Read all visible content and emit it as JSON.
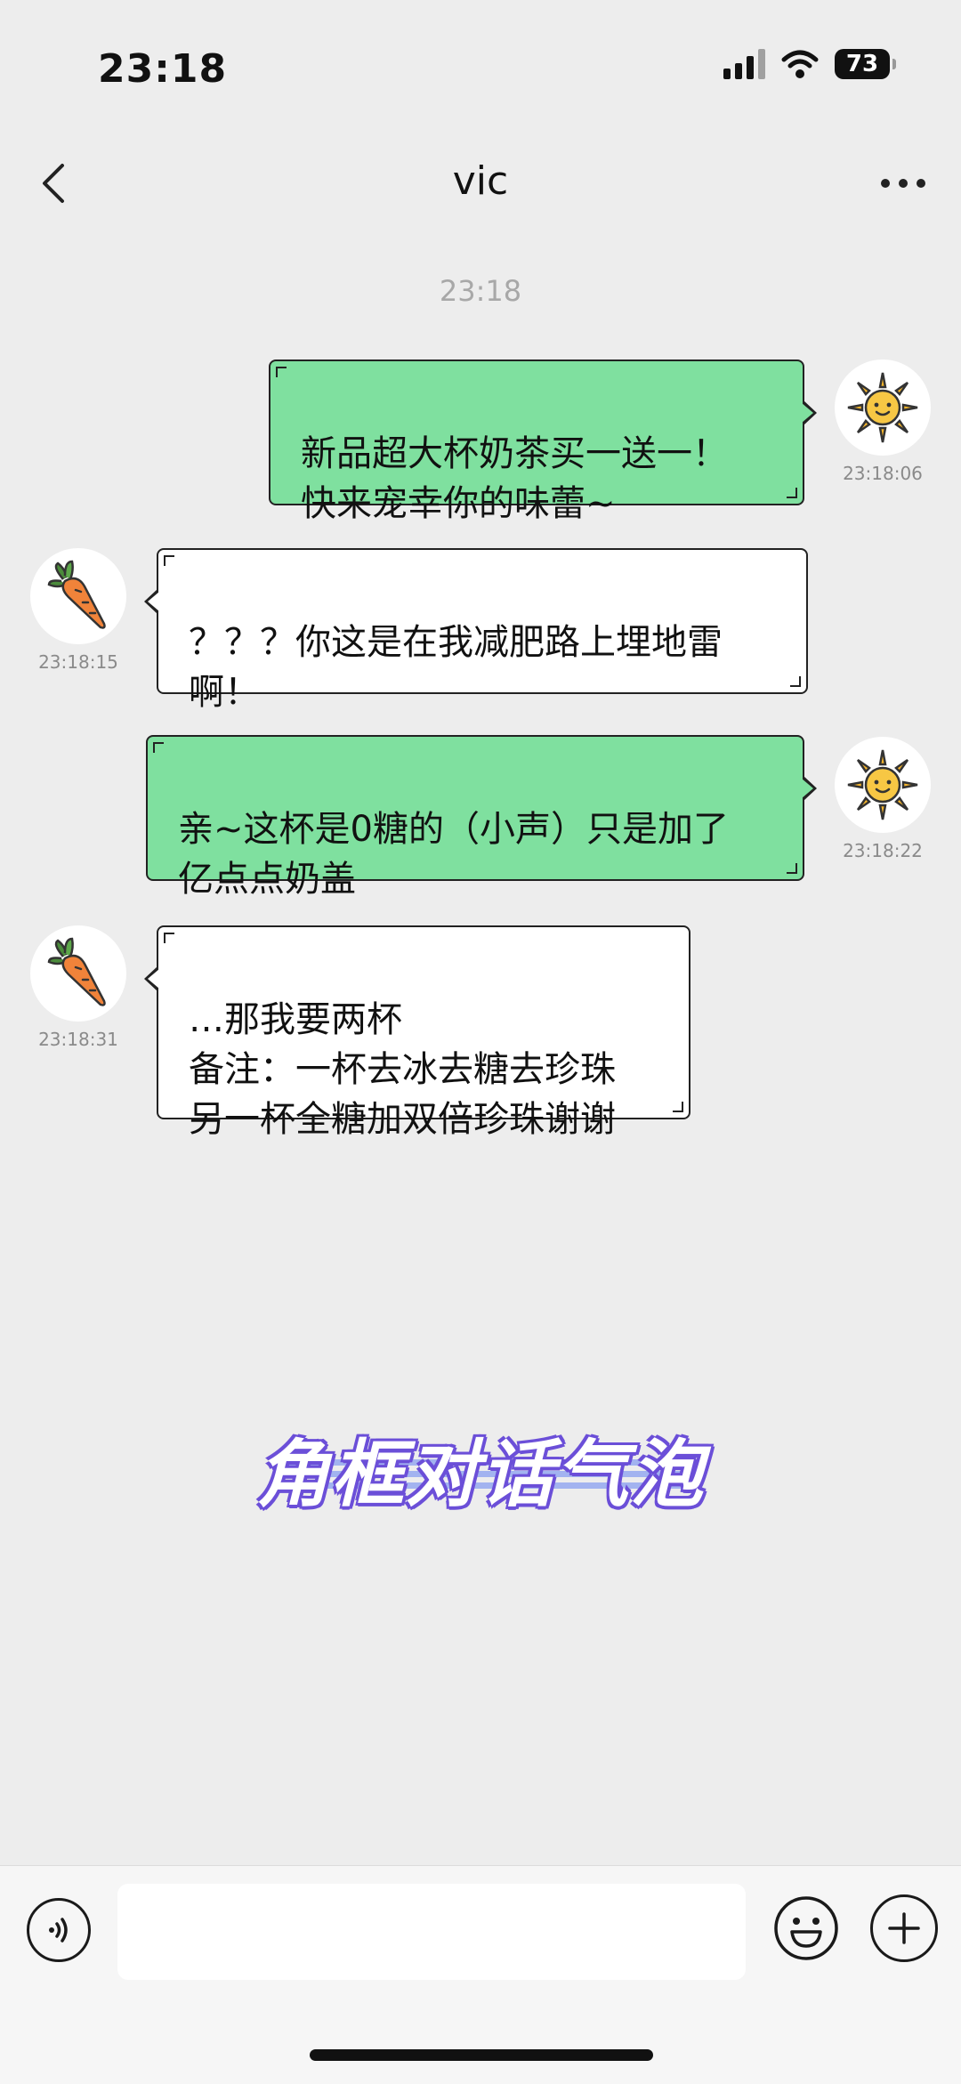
{
  "status_bar": {
    "time": "23:18",
    "battery": "73",
    "icons": [
      "signal-icon",
      "wifi-icon",
      "battery-icon"
    ]
  },
  "nav": {
    "title": "vic",
    "back_icon": "chevron-left-icon",
    "more_icon": "more-dots-icon"
  },
  "center_timestamp": "23:18",
  "messages": [
    {
      "side": "sent",
      "avatar": "sun-avatar",
      "time": "23:18:06",
      "text": "新品超大杯奶茶买一送一！\n快来宠幸你的味蕾~"
    },
    {
      "side": "received",
      "avatar": "carrot-avatar",
      "time": "23:18:15",
      "text": "？？？你这是在我减肥路上埋地雷\n啊！"
    },
    {
      "side": "sent",
      "avatar": "sun-avatar",
      "time": "23:18:22",
      "text": "亲~这杯是0糖的（小声）只是加了\n亿点点奶盖"
    },
    {
      "side": "received",
      "avatar": "carrot-avatar",
      "time": "23:18:31",
      "text": "…那我要两杯\n备注：一杯去冰去糖去珍珠\n另一杯全糖加双倍珍珠谢谢"
    }
  ],
  "caption": "角框对话气泡",
  "input_bar": {
    "value": "",
    "icons": [
      "voice-icon",
      "emoji-icon",
      "plus-icon"
    ]
  },
  "colors": {
    "background": "#ededed",
    "sent_bubble": "#7fe09f",
    "received_bubble": "#ffffff",
    "caption_outline": "#6b4fd8"
  }
}
